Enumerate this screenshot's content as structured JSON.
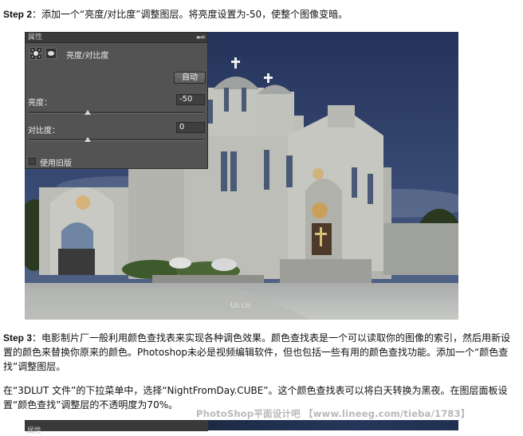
{
  "step2": {
    "label": "Step 2",
    "text": "：添加一个“亮度/对比度”调整图层。将亮度设置为-50，使整个图像变暗。"
  },
  "panel": {
    "tab": "属性",
    "adjustment_name": "亮度/对比度",
    "auto_button": "自动",
    "brightness_label": "亮度：",
    "brightness_value": "-50",
    "brightness_level": -50,
    "contrast_label": "对比度：",
    "contrast_value": "0",
    "contrast_level": 0,
    "legacy_label": "使用旧版",
    "legacy_checked": false
  },
  "photo": {
    "watermark": "UI.cn"
  },
  "step3": {
    "label": "Step 3",
    "para1": "：电影制片厂一般利用颜色查找表来实现各种调色效果。颜色查找表是一个可以读取你的图像的索引，然后用新设置的颜色来替换你原来的颜色。Photoshop未必是视频编辑软件，但也包括一些有用的颜色查找功能。添加一个“颜色查找”调整图层。",
    "para2": "在“3DLUT 文件”的下拉菜单中，选择“NightFromDay.CUBE”。这个颜色查找表可以将白天转换为黑夜。在图层面板设置“颜色查找”调整层的不透明度为70%。"
  },
  "site_watermark": "PhotoShop平面设计吧 【www.lineeg.com/tieba/1783】",
  "bottom_panel_tab": "属性",
  "colors": {
    "panel_bg": "#535353",
    "sky": "#2e3d62",
    "stone": "#b9bab3"
  }
}
